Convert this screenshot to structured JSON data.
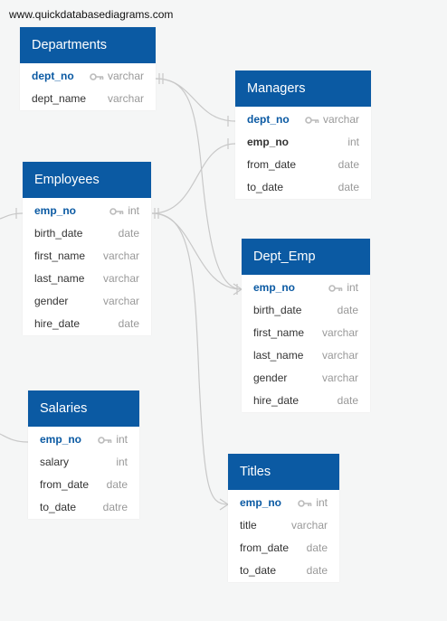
{
  "watermark": "www.quickdatabasediagrams.com",
  "tables": [
    {
      "id": "departments",
      "name": "Departments",
      "columns": [
        {
          "name": "dept_no",
          "type": "varchar",
          "pk": true
        },
        {
          "name": "dept_name",
          "type": "varchar"
        }
      ]
    },
    {
      "id": "managers",
      "name": "Managers",
      "columns": [
        {
          "name": "dept_no",
          "type": "varchar",
          "pk": true
        },
        {
          "name": "emp_no",
          "type": "int",
          "bold": true
        },
        {
          "name": "from_date",
          "type": "date"
        },
        {
          "name": "to_date",
          "type": "date"
        }
      ]
    },
    {
      "id": "employees",
      "name": "Employees",
      "columns": [
        {
          "name": "emp_no",
          "type": "int",
          "pk": true
        },
        {
          "name": "birth_date",
          "type": "date"
        },
        {
          "name": "first_name",
          "type": "varchar"
        },
        {
          "name": "last_name",
          "type": "varchar"
        },
        {
          "name": "gender",
          "type": "varchar"
        },
        {
          "name": "hire_date",
          "type": "date"
        }
      ]
    },
    {
      "id": "dept_emp",
      "name": "Dept_Emp",
      "columns": [
        {
          "name": "emp_no",
          "type": "int",
          "pk": true
        },
        {
          "name": "birth_date",
          "type": "date"
        },
        {
          "name": "first_name",
          "type": "varchar"
        },
        {
          "name": "last_name",
          "type": "varchar"
        },
        {
          "name": "gender",
          "type": "varchar"
        },
        {
          "name": "hire_date",
          "type": "date"
        }
      ]
    },
    {
      "id": "salaries",
      "name": "Salaries",
      "columns": [
        {
          "name": "emp_no",
          "type": "int",
          "pk": true
        },
        {
          "name": "salary",
          "type": "int"
        },
        {
          "name": "from_date",
          "type": "date"
        },
        {
          "name": "to_date",
          "type": "datre"
        }
      ]
    },
    {
      "id": "titles",
      "name": "Titles",
      "columns": [
        {
          "name": "emp_no",
          "type": "int",
          "pk": true
        },
        {
          "name": "title",
          "type": "varchar"
        },
        {
          "name": "from_date",
          "type": "date"
        },
        {
          "name": "to_date",
          "type": "date"
        }
      ]
    }
  ],
  "colors": {
    "header": "#0b5aa3",
    "link": "#c8c8c8",
    "pk_text": "#0b5aa3",
    "type_text": "#999999"
  },
  "icons": {
    "primary_key": "key-icon"
  }
}
